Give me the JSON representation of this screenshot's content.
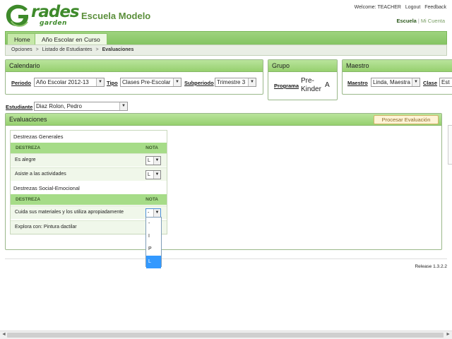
{
  "brand": {
    "logo_main": "rades",
    "logo_sub": "garden",
    "school_name": "Escuela Modelo",
    "colors": {
      "accent": "#3e8a2b",
      "header_green": "#97d06f",
      "selected_blue": "#3399ff"
    }
  },
  "top_bar": {
    "welcome": "Welcome: TEACHER",
    "logout": "Logout",
    "feedback": "Feedback",
    "escuela": "Escuela",
    "separator": "|",
    "mi_cuenta": "Mi Cuenta"
  },
  "tabs": [
    {
      "label": "Home"
    },
    {
      "label": "Año Escolar en Curso"
    }
  ],
  "breadcrumb": {
    "items": [
      "Opciones",
      "Listado de Estudiantes",
      "Evaluaciones"
    ],
    "separator": ">"
  },
  "calendario": {
    "title": "Calendario",
    "periodo_label": "Periodo",
    "periodo_value": "Año Escolar 2012-13",
    "tipo_label": "Tipo",
    "tipo_value": "Clases Pre-Escolar",
    "subperiodo_label": "Subperiodo",
    "subperiodo_value": "Trimestre 3"
  },
  "grupo": {
    "title": "Grupo",
    "programa_label": "Programa",
    "programa_value_line1": "Pre-",
    "programa_value_line2": "Kinder",
    "group_letter": "A"
  },
  "maestro": {
    "title": "Maestro",
    "maestro_label": "Maestro",
    "maestro_value": "Linda, Maestra",
    "clase_label": "Clase",
    "clase_value": "Est"
  },
  "estudiante": {
    "label": "Estudiante",
    "value": "Diaz Rolon, Pedro"
  },
  "evaluaciones": {
    "title": "Evaluaciones",
    "process_button": "Procesar Evaluación",
    "sections": [
      {
        "title": "Destrezas Generales",
        "col_destreza": "DESTREZA",
        "col_nota": "NOTA",
        "rows": [
          {
            "label": "Es alegre",
            "value": "L"
          },
          {
            "label": "Asiste a las actividades",
            "value": "L"
          }
        ]
      },
      {
        "title": "Destrezas Social-Emocional",
        "col_destreza": "DESTREZA",
        "col_nota": "NOTA",
        "rows": [
          {
            "label": "Cuida sus materiales y los utiliza apropiadamente",
            "value": "-"
          },
          {
            "label": "Explora con: Pintura dactilar",
            "value": ""
          }
        ]
      }
    ],
    "dropdown_options": [
      "-",
      "I",
      "P",
      "L"
    ],
    "dropdown_selected": "L"
  },
  "footer": {
    "release": "Release 1.3.2.2"
  },
  "icons": {
    "arrow_down": "▼",
    "scroll_left": "◄",
    "scroll_right": "►"
  }
}
